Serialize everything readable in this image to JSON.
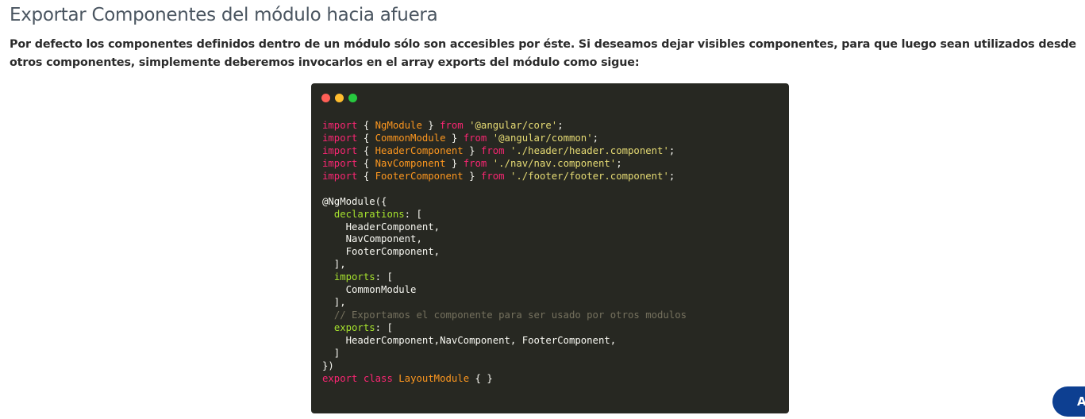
{
  "section": {
    "title": "Exportar Componentes del módulo hacia afuera",
    "intro": "Por defecto los componentes definidos dentro de un módulo sólo son accesibles por éste. Si deseamos dejar visibles componentes, para que luego sean utilizados desde otros componentes, simplemente deberemos invocarlos en el array exports del módulo como sigue:"
  },
  "code_window": {
    "dots": [
      "#ff5f56",
      "#ffbd2e",
      "#27c93f"
    ],
    "colors": {
      "background": "#272822",
      "keyword": "#f92672",
      "ident": "#fd971f",
      "string": "#e6db74",
      "prop": "#a6e22e",
      "comment": "#75715e",
      "plain": "#f8f8f2"
    },
    "lines": [
      [
        [
          "keyword",
          "import"
        ],
        [
          "plain",
          " { "
        ],
        [
          "ident",
          "NgModule"
        ],
        [
          "plain",
          " } "
        ],
        [
          "keyword",
          "from"
        ],
        [
          "plain",
          " "
        ],
        [
          "string",
          "'@angular/core'"
        ],
        [
          "plain",
          ";"
        ]
      ],
      [
        [
          "keyword",
          "import"
        ],
        [
          "plain",
          " { "
        ],
        [
          "ident",
          "CommonModule"
        ],
        [
          "plain",
          " } "
        ],
        [
          "keyword",
          "from"
        ],
        [
          "plain",
          " "
        ],
        [
          "string",
          "'@angular/common'"
        ],
        [
          "plain",
          ";"
        ]
      ],
      [
        [
          "keyword",
          "import"
        ],
        [
          "plain",
          " { "
        ],
        [
          "ident",
          "HeaderComponent"
        ],
        [
          "plain",
          " } "
        ],
        [
          "keyword",
          "from"
        ],
        [
          "plain",
          " "
        ],
        [
          "string",
          "'./header/header.component'"
        ],
        [
          "plain",
          ";"
        ]
      ],
      [
        [
          "keyword",
          "import"
        ],
        [
          "plain",
          " { "
        ],
        [
          "ident",
          "NavComponent"
        ],
        [
          "plain",
          " } "
        ],
        [
          "keyword",
          "from"
        ],
        [
          "plain",
          " "
        ],
        [
          "string",
          "'./nav/nav.component'"
        ],
        [
          "plain",
          ";"
        ]
      ],
      [
        [
          "keyword",
          "import"
        ],
        [
          "plain",
          " { "
        ],
        [
          "ident",
          "FooterComponent"
        ],
        [
          "plain",
          " } "
        ],
        [
          "keyword",
          "from"
        ],
        [
          "plain",
          " "
        ],
        [
          "string",
          "'./footer/footer.component'"
        ],
        [
          "plain",
          ";"
        ]
      ],
      [],
      [
        [
          "plain",
          "@NgModule({"
        ]
      ],
      [
        [
          "plain",
          "  "
        ],
        [
          "prop",
          "declarations"
        ],
        [
          "plain",
          ": ["
        ]
      ],
      [
        [
          "plain",
          "    HeaderComponent,"
        ]
      ],
      [
        [
          "plain",
          "    NavComponent,"
        ]
      ],
      [
        [
          "plain",
          "    FooterComponent,"
        ]
      ],
      [
        [
          "plain",
          "  ],"
        ]
      ],
      [
        [
          "plain",
          "  "
        ],
        [
          "prop",
          "imports"
        ],
        [
          "plain",
          ": ["
        ]
      ],
      [
        [
          "plain",
          "    CommonModule"
        ]
      ],
      [
        [
          "plain",
          "  ],"
        ]
      ],
      [
        [
          "plain",
          "  "
        ],
        [
          "comment",
          "// Exportamos el componente para ser usado por otros modulos"
        ]
      ],
      [
        [
          "plain",
          "  "
        ],
        [
          "prop",
          "exports"
        ],
        [
          "plain",
          ": ["
        ]
      ],
      [
        [
          "plain",
          "    HeaderComponent,NavComponent, FooterComponent,"
        ]
      ],
      [
        [
          "plain",
          "  ]"
        ]
      ],
      [
        [
          "plain",
          "})"
        ]
      ],
      [
        [
          "keyword",
          "export"
        ],
        [
          "plain",
          " "
        ],
        [
          "keyword",
          "class"
        ],
        [
          "plain",
          " "
        ],
        [
          "ident",
          "LayoutModule"
        ],
        [
          "plain",
          " { }"
        ]
      ]
    ]
  },
  "fab": {
    "label": "A",
    "color": "#0d3f91"
  }
}
